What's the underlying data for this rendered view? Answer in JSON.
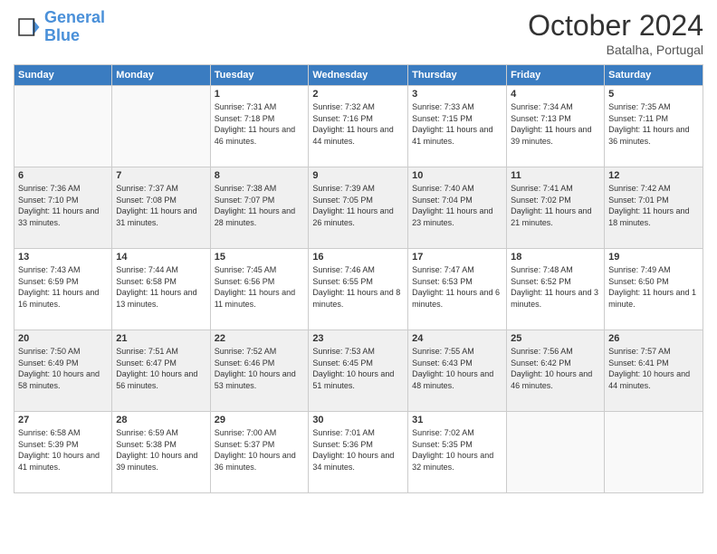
{
  "logo": {
    "line1": "General",
    "line2": "Blue"
  },
  "title": "October 2024",
  "subtitle": "Batalha, Portugal",
  "days_of_week": [
    "Sunday",
    "Monday",
    "Tuesday",
    "Wednesday",
    "Thursday",
    "Friday",
    "Saturday"
  ],
  "weeks": [
    [
      {
        "day": "",
        "info": ""
      },
      {
        "day": "",
        "info": ""
      },
      {
        "day": "1",
        "info": "Sunrise: 7:31 AM\nSunset: 7:18 PM\nDaylight: 11 hours and 46 minutes."
      },
      {
        "day": "2",
        "info": "Sunrise: 7:32 AM\nSunset: 7:16 PM\nDaylight: 11 hours and 44 minutes."
      },
      {
        "day": "3",
        "info": "Sunrise: 7:33 AM\nSunset: 7:15 PM\nDaylight: 11 hours and 41 minutes."
      },
      {
        "day": "4",
        "info": "Sunrise: 7:34 AM\nSunset: 7:13 PM\nDaylight: 11 hours and 39 minutes."
      },
      {
        "day": "5",
        "info": "Sunrise: 7:35 AM\nSunset: 7:11 PM\nDaylight: 11 hours and 36 minutes."
      }
    ],
    [
      {
        "day": "6",
        "info": "Sunrise: 7:36 AM\nSunset: 7:10 PM\nDaylight: 11 hours and 33 minutes."
      },
      {
        "day": "7",
        "info": "Sunrise: 7:37 AM\nSunset: 7:08 PM\nDaylight: 11 hours and 31 minutes."
      },
      {
        "day": "8",
        "info": "Sunrise: 7:38 AM\nSunset: 7:07 PM\nDaylight: 11 hours and 28 minutes."
      },
      {
        "day": "9",
        "info": "Sunrise: 7:39 AM\nSunset: 7:05 PM\nDaylight: 11 hours and 26 minutes."
      },
      {
        "day": "10",
        "info": "Sunrise: 7:40 AM\nSunset: 7:04 PM\nDaylight: 11 hours and 23 minutes."
      },
      {
        "day": "11",
        "info": "Sunrise: 7:41 AM\nSunset: 7:02 PM\nDaylight: 11 hours and 21 minutes."
      },
      {
        "day": "12",
        "info": "Sunrise: 7:42 AM\nSunset: 7:01 PM\nDaylight: 11 hours and 18 minutes."
      }
    ],
    [
      {
        "day": "13",
        "info": "Sunrise: 7:43 AM\nSunset: 6:59 PM\nDaylight: 11 hours and 16 minutes."
      },
      {
        "day": "14",
        "info": "Sunrise: 7:44 AM\nSunset: 6:58 PM\nDaylight: 11 hours and 13 minutes."
      },
      {
        "day": "15",
        "info": "Sunrise: 7:45 AM\nSunset: 6:56 PM\nDaylight: 11 hours and 11 minutes."
      },
      {
        "day": "16",
        "info": "Sunrise: 7:46 AM\nSunset: 6:55 PM\nDaylight: 11 hours and 8 minutes."
      },
      {
        "day": "17",
        "info": "Sunrise: 7:47 AM\nSunset: 6:53 PM\nDaylight: 11 hours and 6 minutes."
      },
      {
        "day": "18",
        "info": "Sunrise: 7:48 AM\nSunset: 6:52 PM\nDaylight: 11 hours and 3 minutes."
      },
      {
        "day": "19",
        "info": "Sunrise: 7:49 AM\nSunset: 6:50 PM\nDaylight: 11 hours and 1 minute."
      }
    ],
    [
      {
        "day": "20",
        "info": "Sunrise: 7:50 AM\nSunset: 6:49 PM\nDaylight: 10 hours and 58 minutes."
      },
      {
        "day": "21",
        "info": "Sunrise: 7:51 AM\nSunset: 6:47 PM\nDaylight: 10 hours and 56 minutes."
      },
      {
        "day": "22",
        "info": "Sunrise: 7:52 AM\nSunset: 6:46 PM\nDaylight: 10 hours and 53 minutes."
      },
      {
        "day": "23",
        "info": "Sunrise: 7:53 AM\nSunset: 6:45 PM\nDaylight: 10 hours and 51 minutes."
      },
      {
        "day": "24",
        "info": "Sunrise: 7:55 AM\nSunset: 6:43 PM\nDaylight: 10 hours and 48 minutes."
      },
      {
        "day": "25",
        "info": "Sunrise: 7:56 AM\nSunset: 6:42 PM\nDaylight: 10 hours and 46 minutes."
      },
      {
        "day": "26",
        "info": "Sunrise: 7:57 AM\nSunset: 6:41 PM\nDaylight: 10 hours and 44 minutes."
      }
    ],
    [
      {
        "day": "27",
        "info": "Sunrise: 6:58 AM\nSunset: 5:39 PM\nDaylight: 10 hours and 41 minutes."
      },
      {
        "day": "28",
        "info": "Sunrise: 6:59 AM\nSunset: 5:38 PM\nDaylight: 10 hours and 39 minutes."
      },
      {
        "day": "29",
        "info": "Sunrise: 7:00 AM\nSunset: 5:37 PM\nDaylight: 10 hours and 36 minutes."
      },
      {
        "day": "30",
        "info": "Sunrise: 7:01 AM\nSunset: 5:36 PM\nDaylight: 10 hours and 34 minutes."
      },
      {
        "day": "31",
        "info": "Sunrise: 7:02 AM\nSunset: 5:35 PM\nDaylight: 10 hours and 32 minutes."
      },
      {
        "day": "",
        "info": ""
      },
      {
        "day": "",
        "info": ""
      }
    ]
  ]
}
